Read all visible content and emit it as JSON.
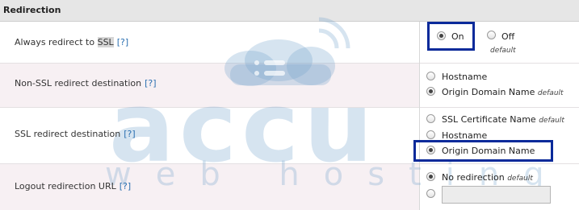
{
  "header": {
    "title": "Redirection"
  },
  "help_label": "[?]",
  "rows": [
    {
      "label_pre": "Always redirect to ",
      "label_hl": "SSL",
      "options": [
        {
          "label": "On",
          "checked": true
        },
        {
          "label": "Off",
          "checked": false,
          "note": "default"
        }
      ]
    },
    {
      "label": "Non-SSL redirect destination",
      "options": [
        {
          "label": "Hostname",
          "checked": false
        },
        {
          "label": "Origin Domain Name",
          "checked": true,
          "note": "default"
        }
      ]
    },
    {
      "label": "SSL redirect destination",
      "options": [
        {
          "label": "SSL Certificate Name",
          "checked": false,
          "note": "default"
        },
        {
          "label": "Hostname",
          "checked": false
        },
        {
          "label": "Origin Domain Name",
          "checked": true
        }
      ]
    },
    {
      "label": "Logout redirection URL",
      "options": [
        {
          "label": "No redirection",
          "checked": true,
          "note": "default"
        },
        {
          "label": "",
          "checked": false,
          "input_value": ""
        }
      ]
    }
  ],
  "watermark": {
    "line1": "accu",
    "line2": "web hosting"
  },
  "colors": {
    "header_bg": "#e6e6e6",
    "alt_row": "#f7f0f3",
    "help_link": "#2a6fb0",
    "highlight_box": "#0a2a9a"
  }
}
